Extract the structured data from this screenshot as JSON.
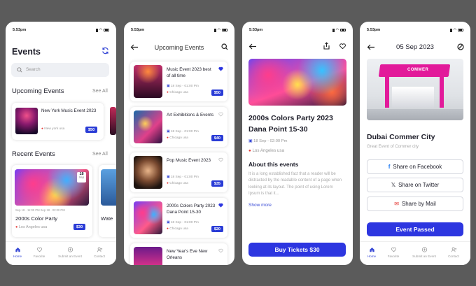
{
  "status_time": "5:53pm",
  "screen1": {
    "title": "Events",
    "search_placeholder": "Search",
    "upcoming_heading": "Upcoming Events",
    "see_all": "See All",
    "upcoming_card": {
      "title": "New York Music Event 2023",
      "location": "New york usa",
      "price": "$50"
    },
    "recent_heading": "Recent Events",
    "recent_see_all": "See All",
    "recent_card": {
      "date_day": "18",
      "date_month": "Sep",
      "time": "Sep 18 · 11:00 PM Sep 18 · 02:00 PM",
      "title": "2000s Color Party",
      "location": "Los Angeles usa",
      "price": "$30"
    },
    "peek_title": "Wate"
  },
  "tabs": [
    {
      "label": "Home",
      "icon": "home-icon"
    },
    {
      "label": "Favorite",
      "icon": "heart-icon"
    },
    {
      "label": "Submit an Event",
      "icon": "plus-circle-icon"
    },
    {
      "label": "Contact",
      "icon": "contact-icon"
    }
  ],
  "screen2": {
    "title": "Upcoming Events",
    "events": [
      {
        "title": "Music Event 2023 best of all time",
        "time": "18 Sep - 01:00 Pm",
        "location": "Chicago usa",
        "price": "$50",
        "liked": true
      },
      {
        "title": "Art Exhibitions & Events",
        "time": "18 Sep - 01:00 Pm",
        "location": "Chicago usa",
        "price": "$40",
        "liked": false
      },
      {
        "title": "Pop Music Event 2023",
        "time": "18 Sep - 01:00 Pm",
        "location": "Chicago usa",
        "price": "$35",
        "liked": false
      },
      {
        "title": "2000s Colors Party 2023 Dana Point 15-30",
        "time": "18 Sep - 01:00 Pm",
        "location": "Chicago usa",
        "price": "$20",
        "liked": true
      },
      {
        "title": "New Year's Eve New Orleans",
        "time": "1 Jan - 01:00 Pm",
        "location": "",
        "price": "",
        "liked": false
      }
    ]
  },
  "screen3": {
    "title": "2000s Colors Party 2023 Dana Point 15-30",
    "time": "18 Sep - 02:00 Pm",
    "location": "Los Angeles usa",
    "about_heading": "About this events",
    "about_text": "It is a long established fact that a reader will be distracted by the readable content of a page when looking at its layout. The point of using Lorem Ipsum is that it...",
    "show_more": "Show more",
    "cta": "Buy Tickets $30"
  },
  "screen4": {
    "date": "05 Sep 2023",
    "title": "Dubai Commer City",
    "subtitle": "Great Event of Commer city",
    "share_facebook": "Share on Facebook",
    "share_twitter": "Share on Twitter",
    "share_mail": "Share by Mail",
    "status_button": "Event Passed",
    "booth_sign": "COMMER"
  },
  "colors": {
    "accent": "#2d36e0",
    "price": "#2a3cd6",
    "location_pin": "#e53935",
    "background": "#5b5b5b"
  }
}
